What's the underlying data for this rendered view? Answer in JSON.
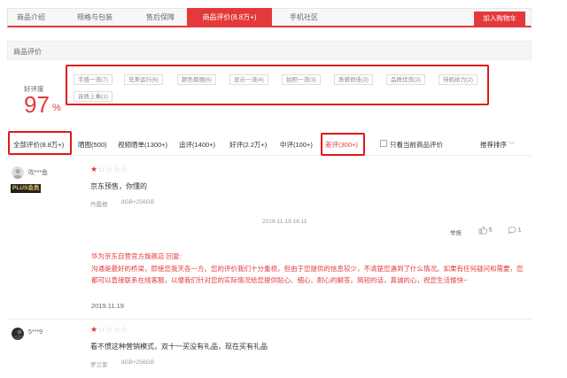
{
  "tabs": [
    {
      "label": "商品介绍",
      "active": false
    },
    {
      "label": "规格与包装",
      "active": false
    },
    {
      "label": "售后保障",
      "active": false
    },
    {
      "label": "商品评价(8.8万+)",
      "active": true
    },
    {
      "label": "手机社区",
      "active": false
    }
  ],
  "cart_button": "加入购物车",
  "section_title": "商品评价",
  "summary": {
    "label": "好评度",
    "value": "97",
    "unit": "%"
  },
  "tags": [
    "手感一流(7)",
    "充美运行(6)",
    "颜色倒丽(6)",
    "显示一流(4)",
    "拍照一流(3)",
    "质感很佳(3)",
    "品质优良(3)",
    "待机给力(2)",
    "音质上乘(1)"
  ],
  "filters": [
    {
      "label": "全部评价(8.8万+)",
      "active": false,
      "boxed": true
    },
    {
      "label": "晒图(500)",
      "active": false,
      "boxed": false
    },
    {
      "label": "视频晒单(1300+)",
      "active": false,
      "boxed": false
    },
    {
      "label": "追评(1400+)",
      "active": false,
      "boxed": false
    },
    {
      "label": "好评(2.2万+)",
      "active": false,
      "boxed": false
    },
    {
      "label": "中评(100+)",
      "active": false,
      "boxed": false
    },
    {
      "label": "差评(300+)",
      "active": true,
      "boxed": true
    }
  ],
  "only_current_label": "只看当前商品评价",
  "sort_label": "推荐排序",
  "reviews": [
    {
      "user": "吹***鱼",
      "badge": "PLUS会员",
      "rating": 1,
      "text": "京东预售，你懂的",
      "color": "丹霞橙",
      "storage": "8GB+256GB",
      "time": "2019-11-19 16:11",
      "report": "举报",
      "likes": "5",
      "comments": "1",
      "reply_head": "华为京东自营官方旗舰店 回复:",
      "reply_body": "沟通是最好的桥梁，即使您我天各一方。您的评价我们十分重视，但由于您提供的信息较少，不清楚您遇到了什么情况。如果有任何疑问和需要，您都可以直接联系在线客服，以便我们针对您的实际情况给您提供贴心、细心、耐心的解答。简短的话，真诚的心，祝您生活愉快~",
      "reply_date": "2019.11.19"
    },
    {
      "user": "5***9",
      "rating": 1,
      "text": "看不惯这种营销模式，双十一买没有礼品，现在买有礼品",
      "color": "罗兰紫",
      "storage": "8GB+256GB"
    }
  ],
  "colors": {
    "accent": "#e4393c",
    "highlight_box": "#e0181c"
  }
}
